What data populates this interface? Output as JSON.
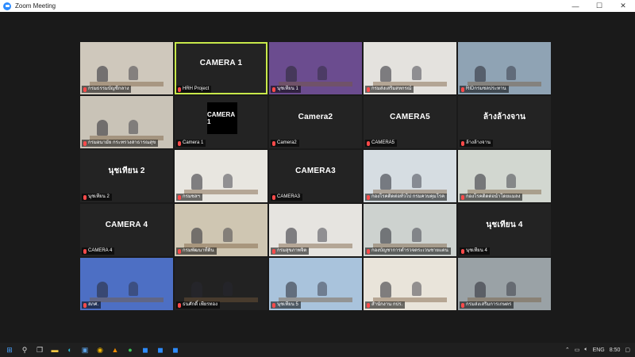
{
  "window": {
    "title": "Zoom Meeting",
    "controls": [
      "—",
      "☐",
      "✕"
    ]
  },
  "tiles": [
    {
      "name": "กรมธรรมบัญชีกลาง",
      "kind": "room",
      "bg": "#cfc8bc"
    },
    {
      "name": "HRH Project",
      "kind": "label",
      "label": "CAMERA 1",
      "active": true
    },
    {
      "name": "นุชเทียน 1",
      "kind": "room",
      "bg": "#6b4c8f"
    },
    {
      "name": "กรมส่งเสริมสหกรณ์",
      "kind": "room",
      "bg": "#e4e2de"
    },
    {
      "name": "RIDกรมชลประทาน",
      "kind": "room",
      "bg": "#8fa3b4"
    },
    {
      "name": "กรมอนามัย กระทรวงสาธารณสุข",
      "kind": "room",
      "bg": "#c9c3b7"
    },
    {
      "name": "Camera 1",
      "kind": "box",
      "label": "CAMERA 1"
    },
    {
      "name": "Camera2",
      "kind": "label",
      "label": "Camera2"
    },
    {
      "name": "CAMERA5",
      "kind": "label",
      "label": "CAMERA5"
    },
    {
      "name": "ล้างล้างจาน",
      "kind": "label",
      "label": "ล้างล้างจาน"
    },
    {
      "name": "นุชเทียน 2",
      "kind": "label",
      "label": "นุชเทียน 2"
    },
    {
      "name": "กรมชลฯ",
      "kind": "room",
      "bg": "#e8e6e0"
    },
    {
      "name": "CAMERA3",
      "kind": "label",
      "label": "CAMERA3"
    },
    {
      "name": "กองโรคติดต่อทั่วไป กรมควบคุมโรค",
      "kind": "room",
      "bg": "#d6dde2"
    },
    {
      "name": "กองโรคติดต่อนำโดยแมลง",
      "kind": "room",
      "bg": "#d2d7d0"
    },
    {
      "name": "CAMERA 4",
      "kind": "label",
      "label": "CAMERA 4"
    },
    {
      "name": "กรมพัฒนาที่ดิน",
      "kind": "room",
      "bg": "#cfc6b2"
    },
    {
      "name": "กรมสุขภาพจิต",
      "kind": "room",
      "bg": "#e6e4e0"
    },
    {
      "name": "กองบัญชาการตำรวจตระเวนชายแดน",
      "kind": "room",
      "bg": "#cdd2cf"
    },
    {
      "name": "นุชเทียน 4",
      "kind": "label",
      "label": "นุชเทียน 4"
    },
    {
      "name": "สภศ.",
      "kind": "room",
      "bg": "#4d6fc4"
    },
    {
      "name": "ธนศักดิ์ เพียรทอง",
      "kind": "room",
      "bg": "#222222"
    },
    {
      "name": "นุชเทียน 5",
      "kind": "room",
      "bg": "#a9c3dc"
    },
    {
      "name": "สำนักงาน กปร.",
      "kind": "room",
      "bg": "#e9e4da"
    },
    {
      "name": "กรมส่งเสริมการเกษตร",
      "kind": "room",
      "bg": "#9aa2a6"
    }
  ],
  "taskbar": {
    "icons": [
      {
        "name": "windows-start-icon",
        "glyph": "⊞",
        "color": "#4aa3ff"
      },
      {
        "name": "search-icon",
        "glyph": "⚲",
        "color": "#dddddd"
      },
      {
        "name": "task-view-icon",
        "glyph": "❐",
        "color": "#dddddd"
      },
      {
        "name": "file-explorer-icon",
        "glyph": "▬",
        "color": "#f2c744"
      },
      {
        "name": "edge-icon",
        "glyph": "◐",
        "color": "#2fb3c9"
      },
      {
        "name": "store-icon",
        "glyph": "▣",
        "color": "#5aa0e6"
      },
      {
        "name": "chrome-icon",
        "glyph": "◉",
        "color": "#f0b400"
      },
      {
        "name": "vlc-icon",
        "glyph": "▲",
        "color": "#f08a00"
      },
      {
        "name": "line-icon",
        "glyph": "●",
        "color": "#3cc85a"
      },
      {
        "name": "zoom-icon",
        "glyph": "◼",
        "color": "#2d8cff"
      },
      {
        "name": "zoom-meeting-icon",
        "glyph": "◼",
        "color": "#2d8cff"
      },
      {
        "name": "zoom-chat-icon",
        "glyph": "◼",
        "color": "#2d8cff"
      }
    ],
    "tray": {
      "lang": "ENG",
      "clock": "8:50"
    }
  }
}
